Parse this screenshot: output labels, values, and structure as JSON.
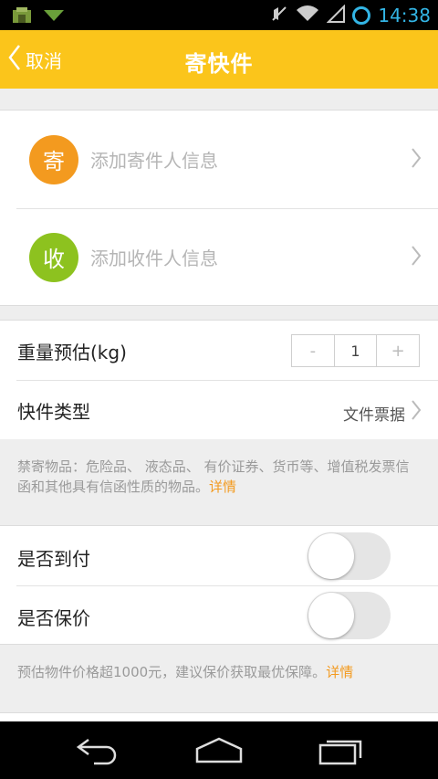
{
  "status_bar": {
    "time": "14:38"
  },
  "header": {
    "back_label": "取消",
    "title": "寄快件"
  },
  "contacts": {
    "sender": {
      "avatar_char": "寄",
      "placeholder": "添加寄件人信息"
    },
    "receiver": {
      "avatar_char": "收",
      "placeholder": "添加收件人信息"
    }
  },
  "options": {
    "weight_label": "重量预估(kg)",
    "weight_minus": "-",
    "weight_value": "1",
    "weight_plus": "+",
    "type_label": "快件类型",
    "type_value": "文件票据"
  },
  "notice_prohibited": {
    "text": "禁寄物品：危险品、 液态品、 有价证券、货币等、增值税发票信函和其他具有信函性质的物品。",
    "link": "详情"
  },
  "toggles": {
    "cod_label": "是否到付",
    "cod_on": false,
    "insure_label": "是否保价",
    "insure_on": false
  },
  "notice_insure": {
    "text": "预估物件价格超1000元，建议保价获取最优保障。",
    "link": "详情"
  },
  "colors": {
    "header": "#fbc51b",
    "sender_avatar": "#f39a1f",
    "receiver_avatar": "#8dc21f",
    "link": "#f39a1f",
    "status_accent": "#33b5e5"
  }
}
